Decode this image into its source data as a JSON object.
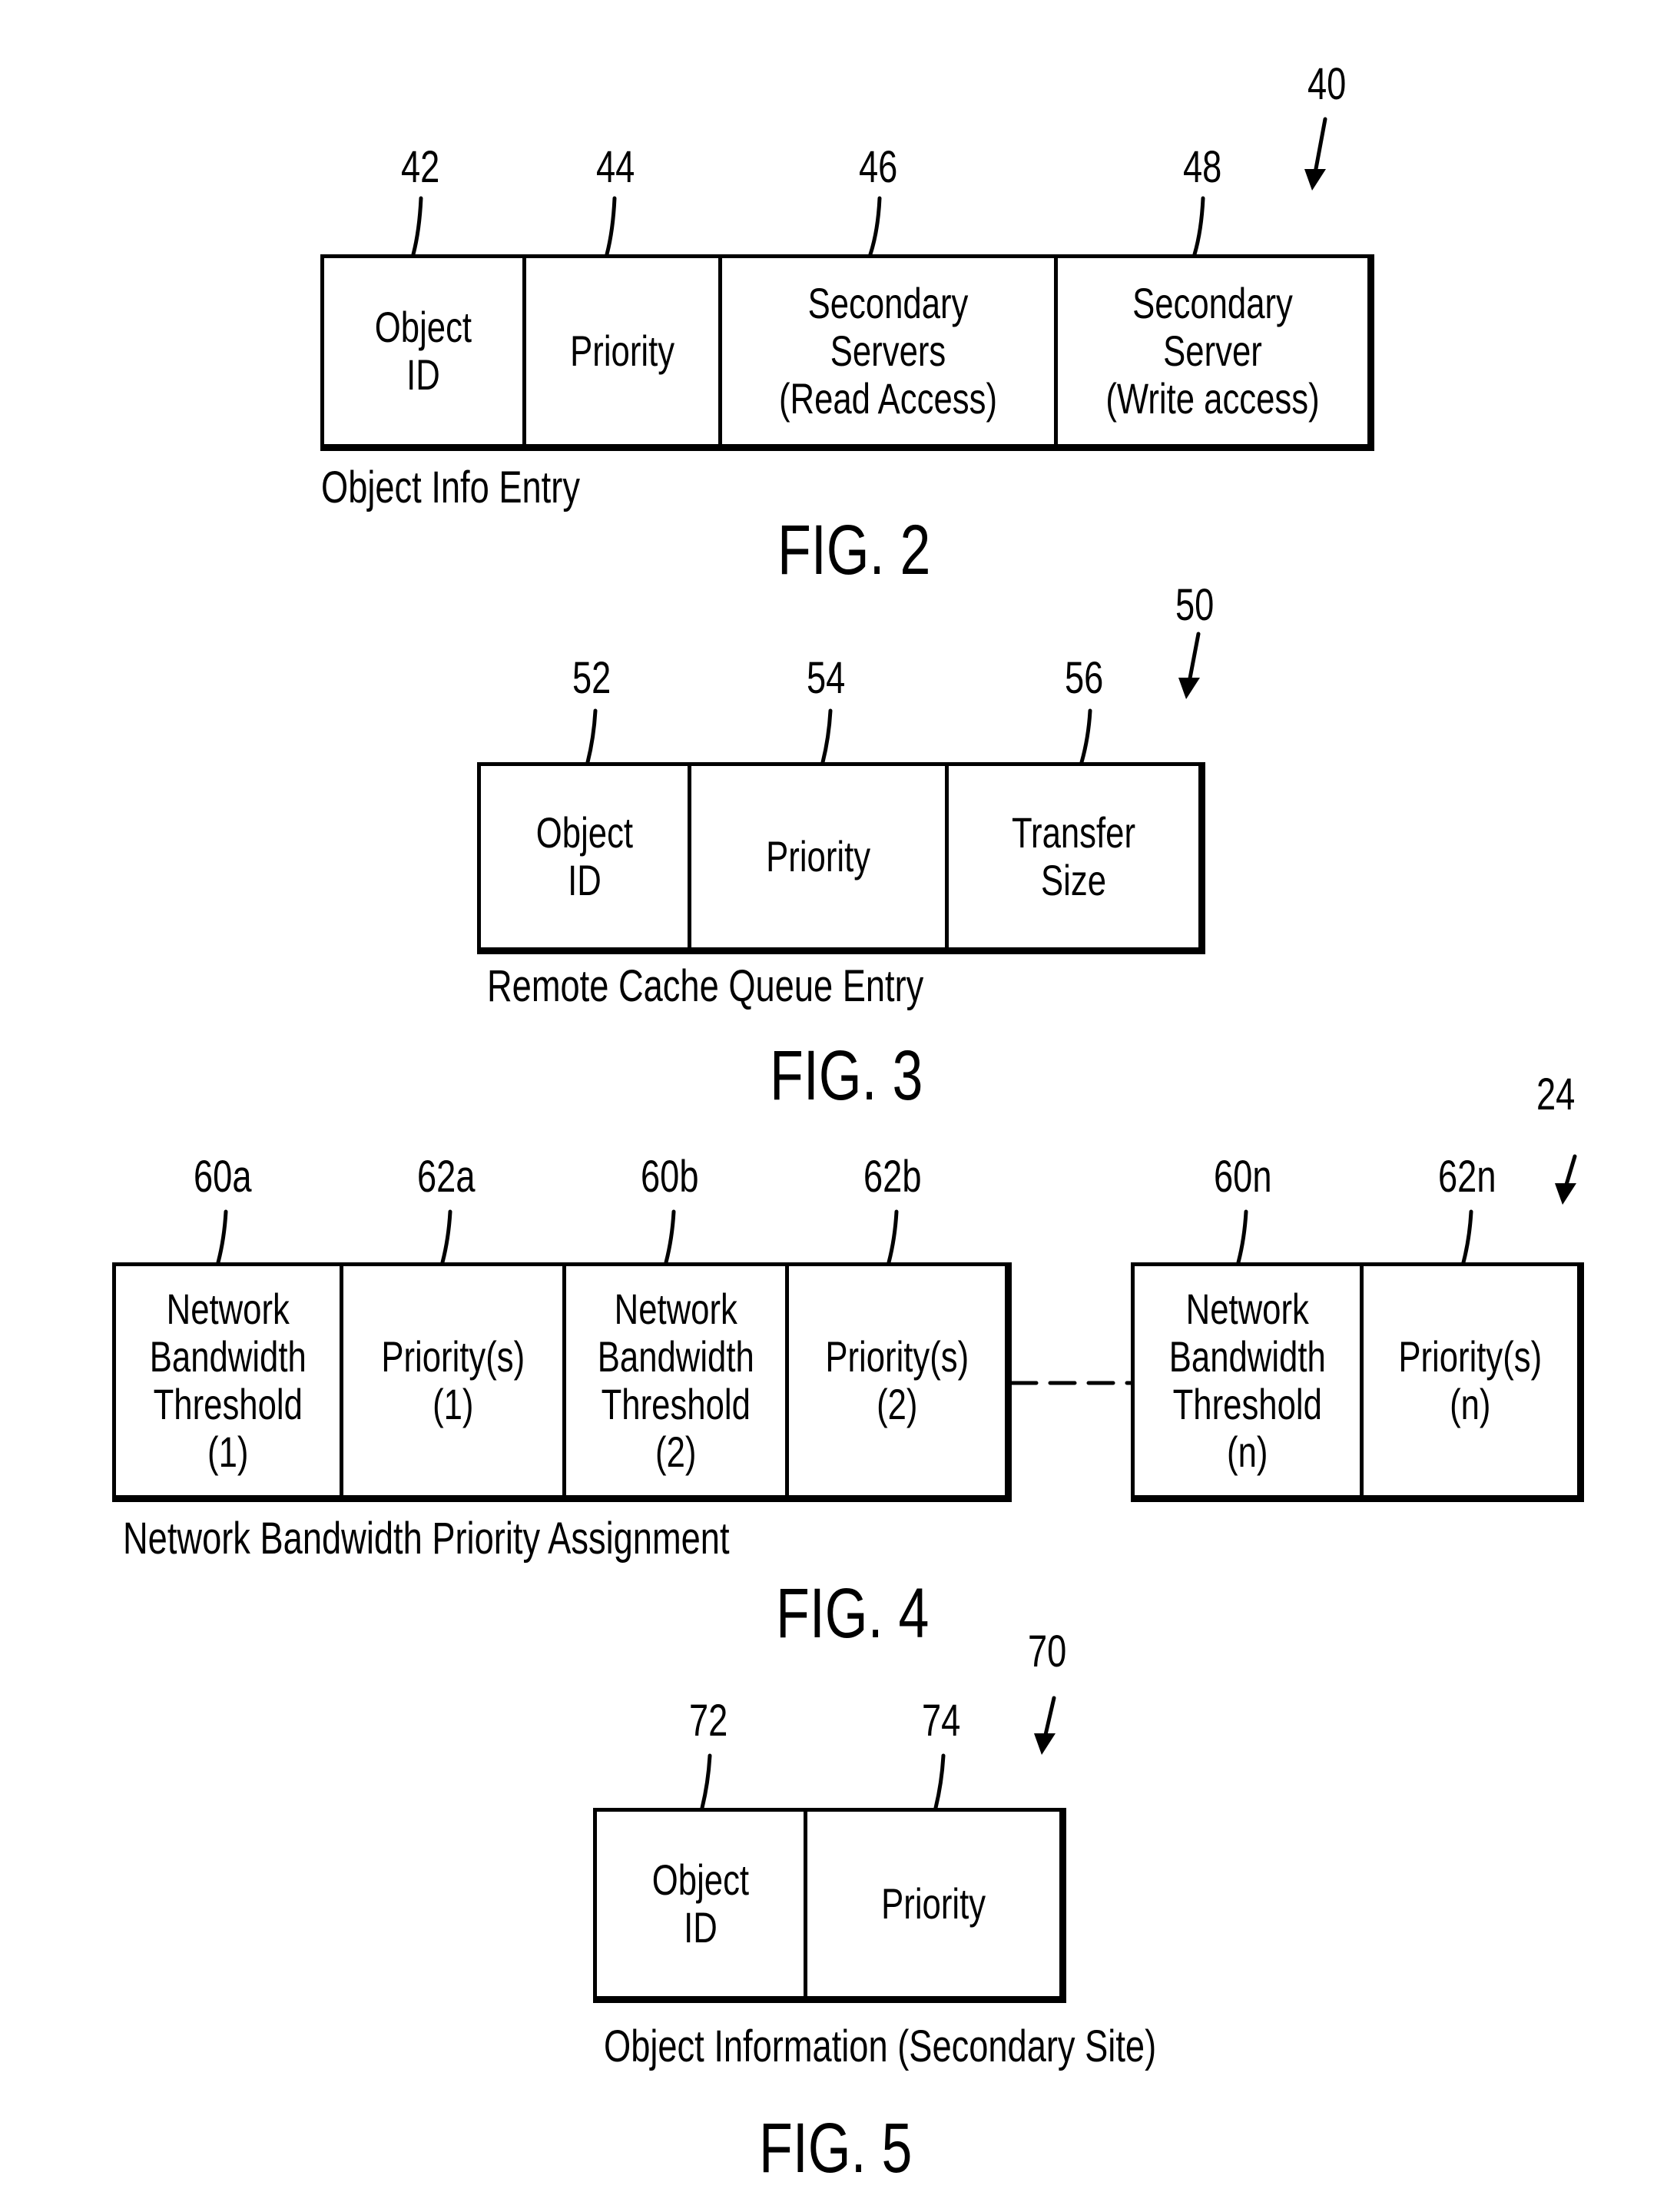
{
  "fig2": {
    "figure_label": "FIG. 2",
    "caption": "Object Info Entry",
    "ref_main": "40",
    "fields": [
      {
        "ref": "42",
        "label": "Object\nID"
      },
      {
        "ref": "44",
        "label": "Priority"
      },
      {
        "ref": "46",
        "label": "Secondary Servers\n(Read Access)"
      },
      {
        "ref": "48",
        "label": "Secondary Server\n(Write access)"
      }
    ]
  },
  "fig3": {
    "figure_label": "FIG. 3",
    "caption": "Remote Cache Queue Entry",
    "ref_main": "50",
    "fields": [
      {
        "ref": "52",
        "label": "Object\nID"
      },
      {
        "ref": "54",
        "label": "Priority"
      },
      {
        "ref": "56",
        "label": "Transfer Size"
      }
    ]
  },
  "fig4": {
    "figure_label": "FIG. 4",
    "caption": "Network Bandwidth Priority Assignment",
    "ref_main": "24",
    "fields": [
      {
        "ref": "60a",
        "label": "Network\nBandwidth\nThreshold\n(1)"
      },
      {
        "ref": "62a",
        "label": "Priority(s)\n(1)"
      },
      {
        "ref": "60b",
        "label": "Network\nBandwidth\nThreshold\n(2)"
      },
      {
        "ref": "62b",
        "label": "Priority(s)\n(2)"
      },
      {
        "ref": "60n",
        "label": "Network\nBandwidth\nThreshold\n(n)"
      },
      {
        "ref": "62n",
        "label": "Priority(s)\n(n)"
      }
    ]
  },
  "fig5": {
    "figure_label": "FIG. 5",
    "caption": "Object Information (Secondary Site)",
    "ref_main": "70",
    "fields": [
      {
        "ref": "72",
        "label": "Object\nID"
      },
      {
        "ref": "74",
        "label": "Priority"
      }
    ]
  }
}
